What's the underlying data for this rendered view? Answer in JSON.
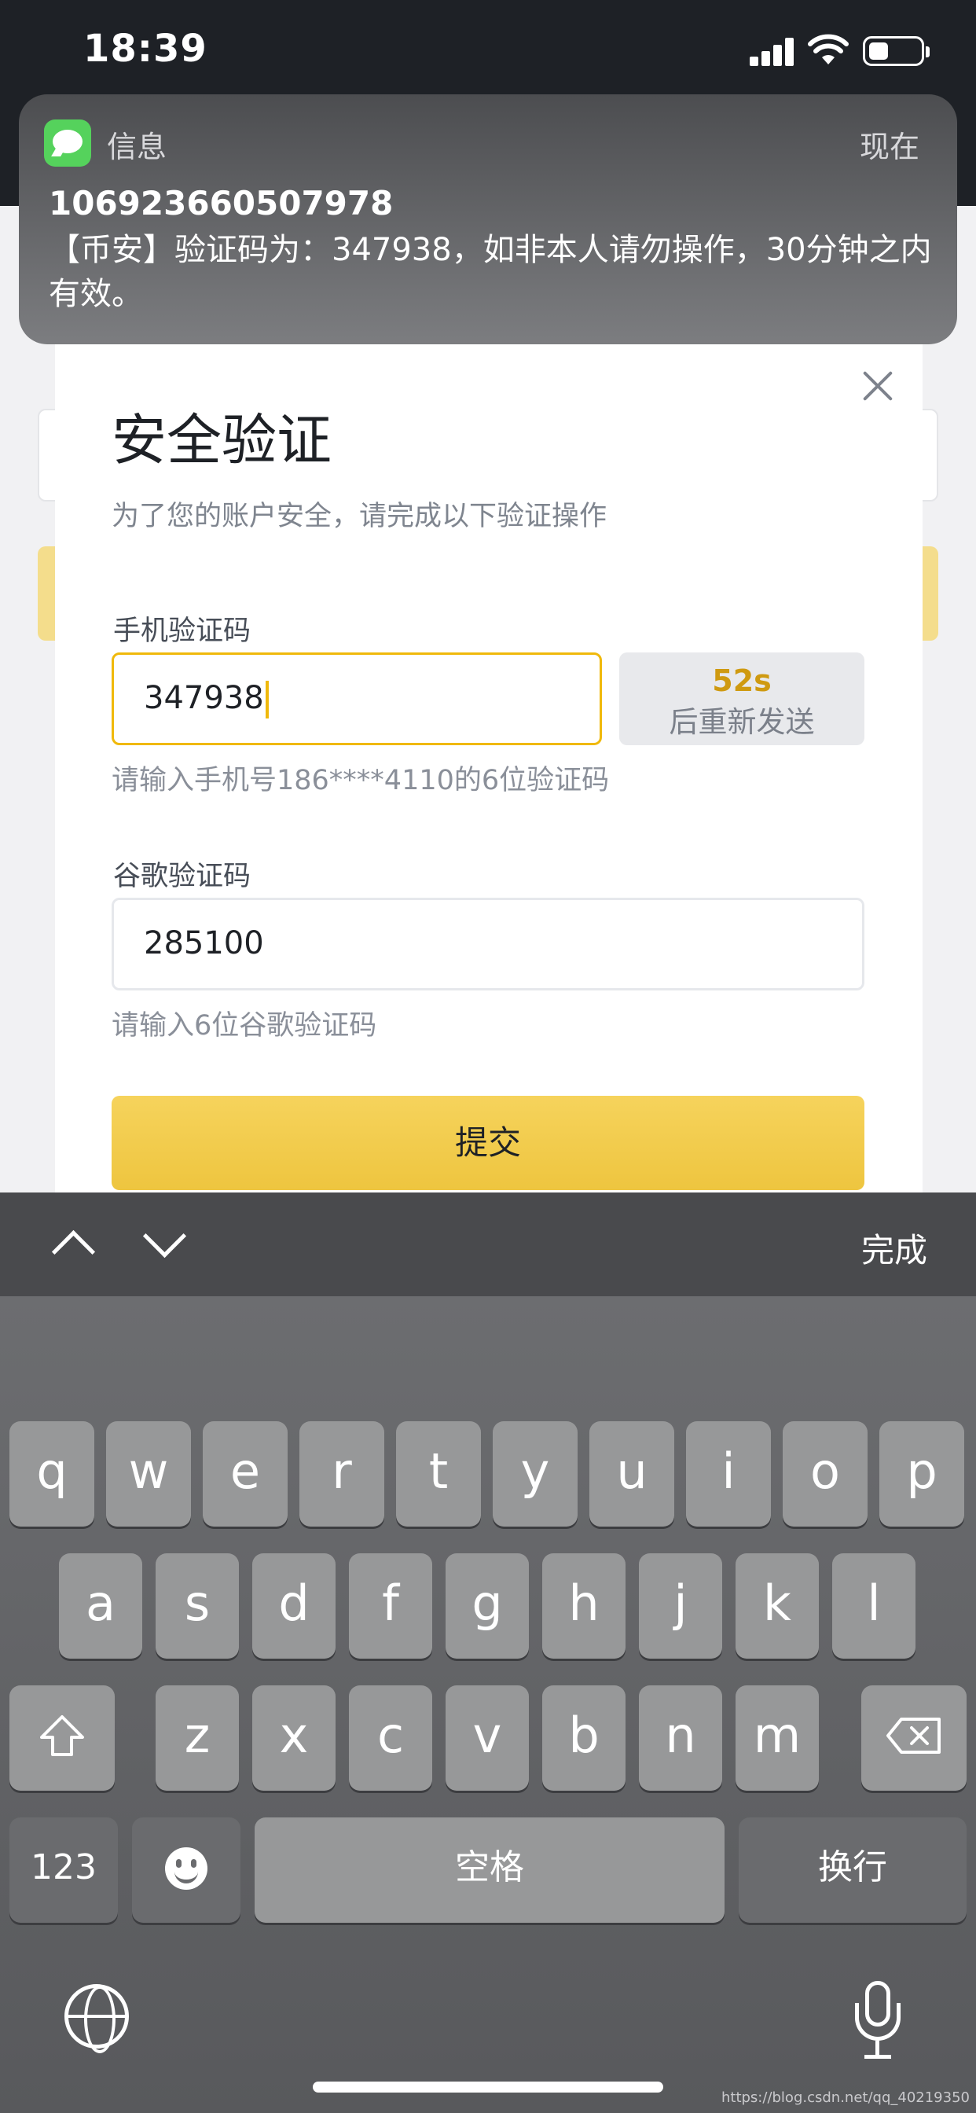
{
  "status_bar": {
    "time": "18:39"
  },
  "notification": {
    "app": "信息",
    "time": "现在",
    "sender": "106923660507978",
    "body": "【币安】验证码为：347938，如非本人请勿操作，30分钟之内有效。"
  },
  "modal": {
    "title": "安全验证",
    "subtitle": "为了您的账户安全，请完成以下验证操作",
    "phone_code": {
      "label": "手机验证码",
      "value": "347938",
      "hint": "请输入手机号186****4110的6位验证码",
      "resend_countdown": "52s",
      "resend_text": "后重新发送"
    },
    "google_code": {
      "label": "谷歌验证码",
      "value": "285100",
      "hint": "请输入6位谷歌验证码"
    },
    "submit_label": "提交"
  },
  "keyboard": {
    "toolbar_done": "完成",
    "row1": [
      "q",
      "w",
      "e",
      "r",
      "t",
      "y",
      "u",
      "i",
      "o",
      "p"
    ],
    "row2": [
      "a",
      "s",
      "d",
      "f",
      "g",
      "h",
      "j",
      "k",
      "l"
    ],
    "row3": [
      "z",
      "x",
      "c",
      "v",
      "b",
      "n",
      "m"
    ],
    "numbers_key": "123",
    "space_key": "空格",
    "return_key": "换行"
  },
  "watermark": "https://blog.csdn.net/qq_40219350",
  "colors": {
    "accent": "#f0b90b",
    "submit": "#f0c94a",
    "countdown": "#cf9a11"
  }
}
